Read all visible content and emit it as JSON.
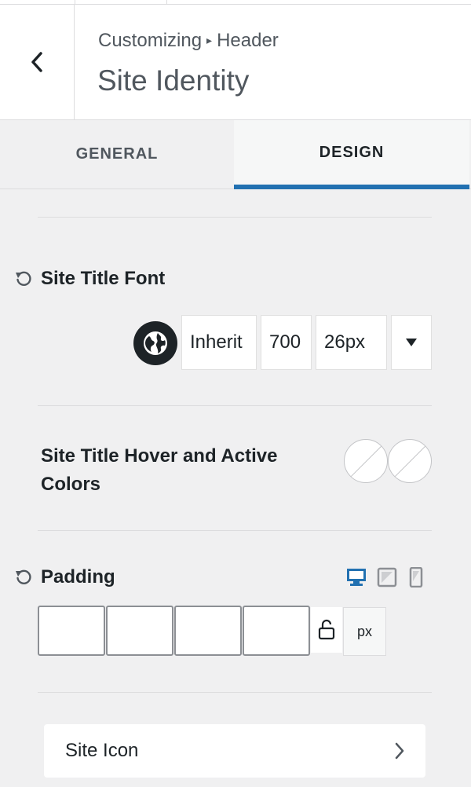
{
  "header": {
    "breadcrumb_parent": "Customizing",
    "breadcrumb_arrow": "▸",
    "breadcrumb_child": "Header",
    "title": "Site Identity"
  },
  "tabs": [
    {
      "label": "GENERAL",
      "active": false
    },
    {
      "label": "DESIGN",
      "active": true
    }
  ],
  "site_title_font": {
    "label": "Site Title Font",
    "family": "Inherit",
    "weight": "700",
    "size": "26px",
    "dropdown_glyph": "▼"
  },
  "hover_colors": {
    "label_line1": "Site Title Hover and Active",
    "label_line2": "Colors"
  },
  "padding": {
    "label": "Padding",
    "unit": "px",
    "values": [
      "",
      "",
      "",
      ""
    ]
  },
  "site_icon": {
    "label": "Site Icon"
  },
  "colors": {
    "accent": "#2271b1",
    "text": "#1d2327",
    "muted": "#50575e",
    "panel_bg": "#f0f0f1"
  },
  "icons": [
    "chevron-left-icon",
    "reset-icon",
    "globe-icon",
    "caret-down-icon",
    "desktop-icon",
    "tablet-icon",
    "mobile-icon",
    "unlock-icon",
    "chevron-right-icon"
  ]
}
